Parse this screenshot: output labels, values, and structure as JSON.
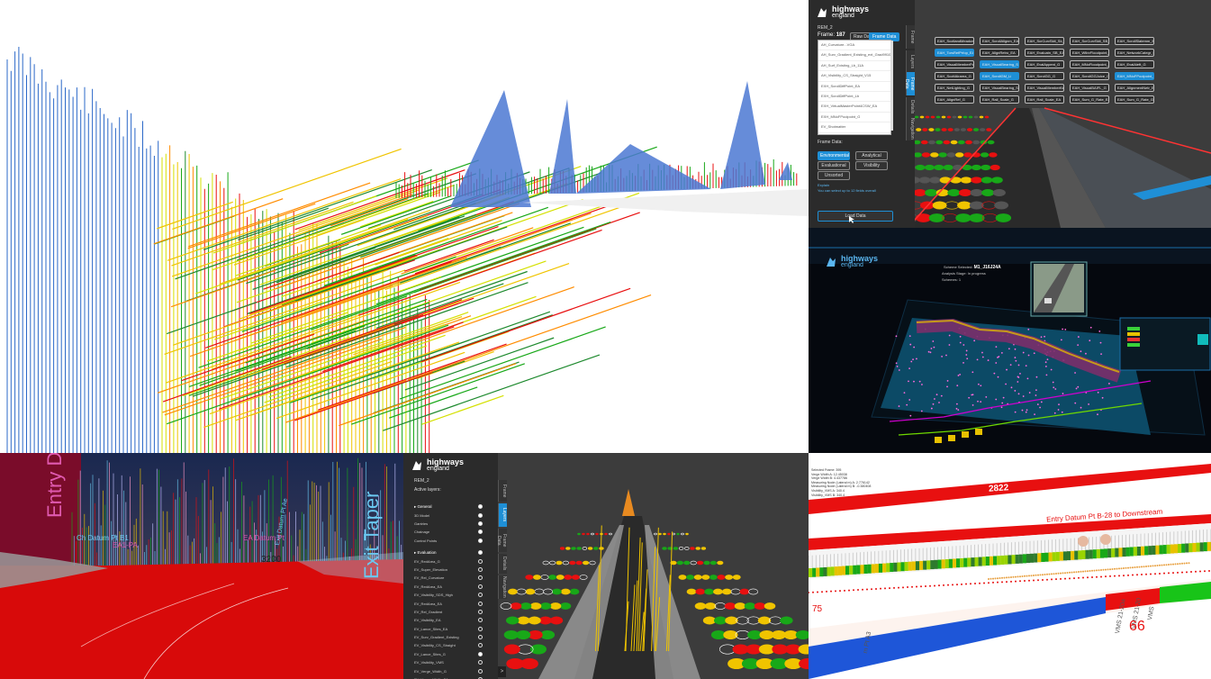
{
  "brand": {
    "name": "highways",
    "sub": "england"
  },
  "frame_panel": {
    "project": "REM_2",
    "frame_label": "Frame:",
    "frame_number": "187",
    "tab_raw": "Raw Data",
    "tab_frame": "Frame Data",
    "list_items": [
      "AH_Curvature...VGA",
      "AH_Surv_Gradient_Existing_ext_Grad9910_RPB2",
      "AH_Surf_Existing_Lb_11A",
      "AH_Visibility_CS_Straight_V15",
      "EXH_ScrollDiffPoint_EA",
      "EXH_ScrollDiffPoint_Lb",
      "EXH_VirtualMasterPoint4CSW_EA",
      "EXH_MNoFPoolpoint_G",
      "EV_Shotmatter",
      "EV_Visibility_RD770B_LOD_5"
    ],
    "frame_data_label": "Frame Data:",
    "chips": [
      {
        "label": "Environmental",
        "active": true
      },
      {
        "label": "Analytical",
        "active": false
      },
      {
        "label": "Evaluational",
        "active": false
      },
      {
        "label": "Visibility",
        "active": false
      },
      {
        "label": "Unsorted",
        "active": false
      }
    ],
    "hint_title": "Explain",
    "hint_text": "You can select up to 12 fields overall",
    "load_button": "Load Data",
    "side_tabs": [
      "Frame",
      "Layers",
      "Frame Data",
      "Details",
      "Navigation"
    ],
    "tag_buttons": [
      {
        "label": "EAH_ScotlandMeadows",
        "active": false
      },
      {
        "label": "EAH_ScrollAlignm_EA",
        "active": false
      },
      {
        "label": "EAH_ScrCurvSkit_Sb_EA",
        "active": false
      },
      {
        "label": "EAH_ScrCurvSkit_SB_EA",
        "active": false
      },
      {
        "label": "EAH_ScrollSlatemm_EA",
        "active": false
      },
      {
        "label": "EAH_TorsRefPrfop_EA",
        "active": true
      },
      {
        "label": "EAH_AlignRetro_EA",
        "active": false
      },
      {
        "label": "EAH_Evaluatn_SB_EA",
        "active": false
      },
      {
        "label": "EAH_WtlnrFloodpoint_EA",
        "active": false
      },
      {
        "label": "EAH_NetworkCategr_SB_EA",
        "active": false
      },
      {
        "label": "EAH_VisualMemberPoint_SB",
        "active": false
      },
      {
        "label": "EAH_VisualBearing_SB_EA",
        "active": true
      },
      {
        "label": "EAH_EvalAppent_G",
        "active": false
      },
      {
        "label": "EAH_MNoFloodpoint_SB",
        "active": false
      },
      {
        "label": "EAH_EvalAleft_G",
        "active": false
      },
      {
        "label": "EAH_ScottAirarea_G",
        "active": false
      },
      {
        "label": "EAH_ScrollGM_Li",
        "active": true
      },
      {
        "label": "EAH_ScrolGG_G",
        "active": false
      },
      {
        "label": "EAH_ScrollGGJuice_G",
        "active": false
      },
      {
        "label": "EAH_MNoFPoolpoint_G",
        "active": true
      },
      {
        "label": "EAH_NetLighting_G",
        "active": false
      },
      {
        "label": "EAH_VisualBearing_SB_G",
        "active": false
      },
      {
        "label": "EAH_VisualMemberKind2",
        "active": false
      },
      {
        "label": "EAH_VisualBAIFL_G",
        "active": false
      },
      {
        "label": "EAH_AlignmentNetr_EA",
        "active": false
      },
      {
        "label": "EAH_AlignRef_G",
        "active": false
      },
      {
        "label": "EAH_Rail_Scale_G",
        "active": false
      },
      {
        "label": "EAH_Rail_Scale_EA",
        "active": false
      },
      {
        "label": "EAH_Sum_G_Rate_EA",
        "active": false
      },
      {
        "label": "EAH_Sum_G_Rate_G",
        "active": false
      }
    ]
  },
  "control_room": {
    "title_prefix": "Scheme Selected:",
    "scheme": "M1_J16J24A",
    "stage": "Analysis Stage: In progress",
    "schemes": "Schemes: 1"
  },
  "scene_4": {
    "entry": "Entry D",
    "exit": "Exit Taper",
    "labels": [
      "Ch Datum Pt B1",
      "EA1-PA",
      "EA Datum Pt",
      "Exit Datum Pt Ae"
    ],
    "chainage": "3200"
  },
  "layers_panel": {
    "project": "REM_2",
    "active_layers": "Active layers:",
    "general_header": "General",
    "general": [
      {
        "label": "3D Model",
        "on": true
      },
      {
        "label": "Gantries",
        "on": true
      },
      {
        "label": "Chainage",
        "on": true
      },
      {
        "label": "Control Points",
        "on": true
      }
    ],
    "evaluation_header": "Evaluation",
    "evaluation": [
      {
        "label": "EV_RedArea_G",
        "on": false
      },
      {
        "label": "EV_Super_Elevation",
        "on": false
      },
      {
        "label": "EV_Rel_Curvature",
        "on": false
      },
      {
        "label": "EV_RedArea_EA",
        "on": false
      },
      {
        "label": "EV_Visibility_SDS_High",
        "on": false
      },
      {
        "label": "EV_RedArea_EA",
        "on": false
      },
      {
        "label": "EV_Rel_Gradient",
        "on": false
      },
      {
        "label": "EV_Visibility_EA",
        "on": false
      },
      {
        "label": "EV_Lance_Sites_EA",
        "on": false
      },
      {
        "label": "EV_Surv_Gradient_Existing",
        "on": false
      },
      {
        "label": "EV_Visibility_CS_Straight",
        "on": false
      },
      {
        "label": "EV_Lance_Sites_G",
        "on": true
      },
      {
        "label": "EV_Visibility_VMS",
        "on": false
      },
      {
        "label": "EV_Verge_Width_G",
        "on": false
      },
      {
        "label": "EV_Verge_Width_EA",
        "on": false
      }
    ],
    "side_tabs": [
      "Frame",
      "Layers",
      "Frame Data",
      "Details",
      "Navigation"
    ],
    "collapse": ">"
  },
  "panel_6": {
    "info_lines": [
      "Selected Frame: 395",
      "Verge Width A: 12.45038",
      "Verge Width B: 4.437786",
      "Measuring Node (Lateral m) A: 2.776142",
      "Measuring Node (Lateral m) B: -0.380408",
      "Visibility_VMS A: 340.4",
      "Visibility_VMS B: 340.4"
    ],
    "chainage": "2822",
    "datum_label": "Entry Datum Pt B-28 to Downstream",
    "vms1": "VMS 21-20a",
    "vms2": "VMS 21-20",
    "vms3": "VMS",
    "num_left": "75",
    "datum_left": "m Pt A3",
    "num_right": "66"
  }
}
